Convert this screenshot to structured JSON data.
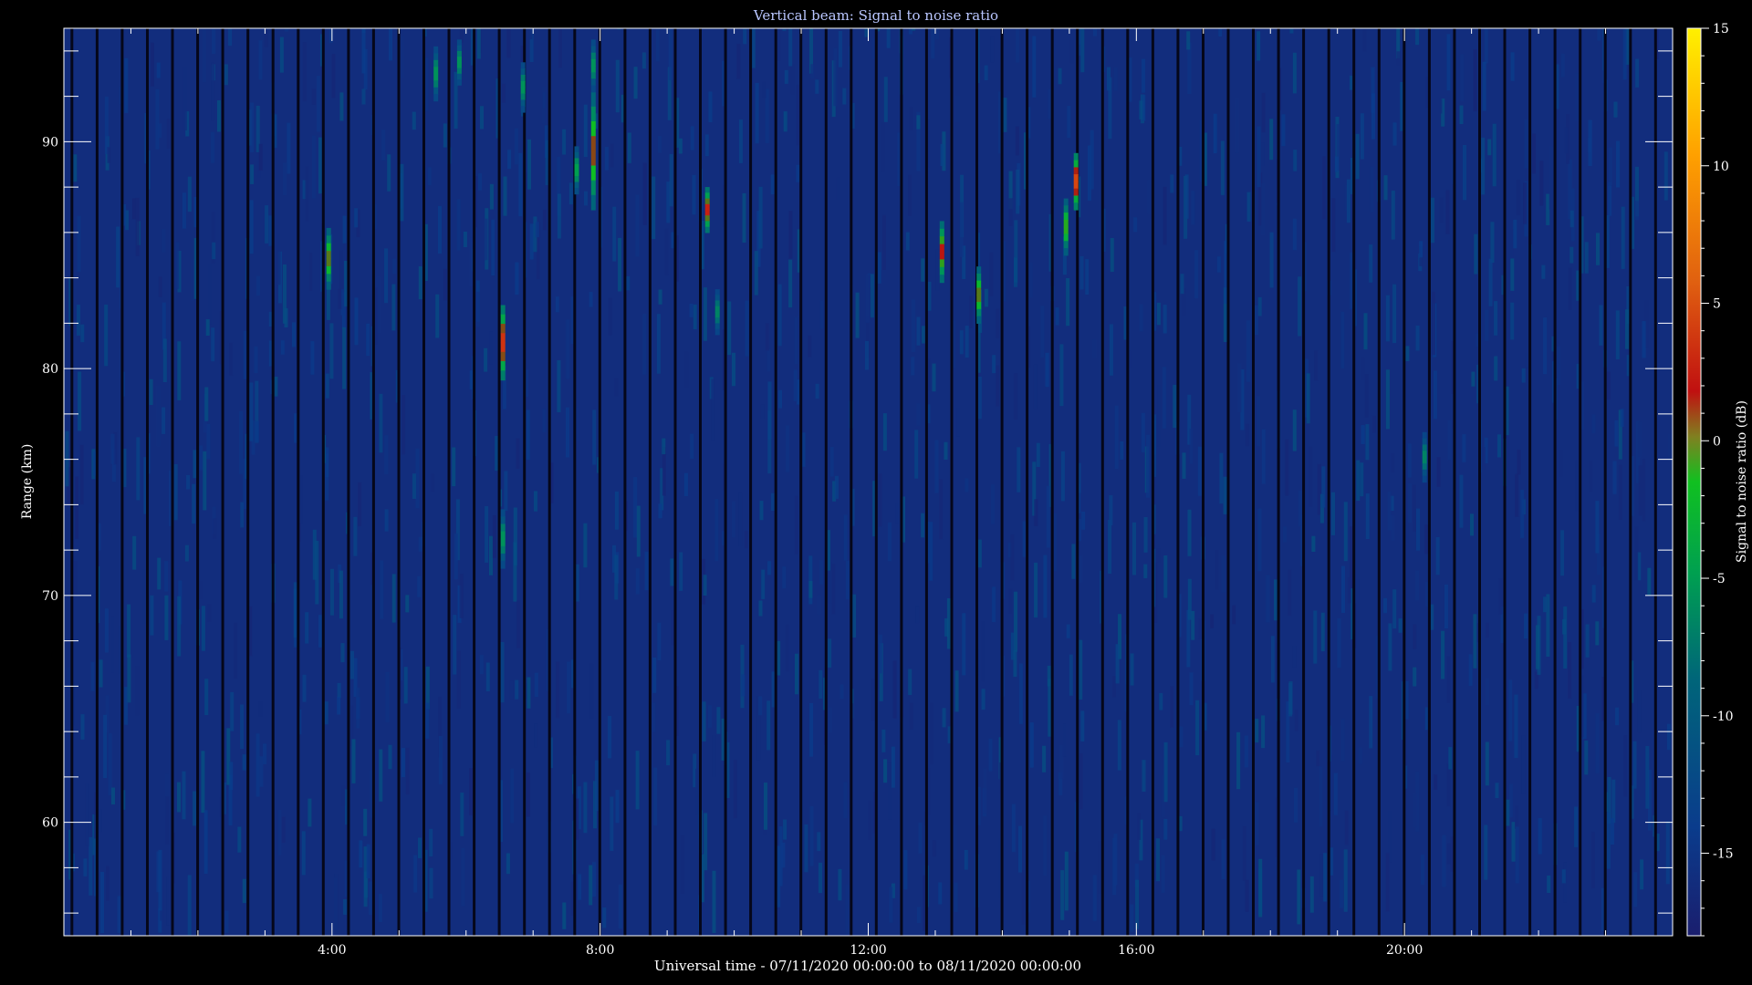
{
  "chart_data": {
    "type": "heatmap",
    "title": "Vertical beam: Signal to noise ratio",
    "xlabel": "Universal time - 07/11/2020 00:00:00 to 08/11/2020 00:00:00",
    "ylabel": "Range (km)",
    "colorbar_label": "Signal to noise ratio (dB)",
    "x_unit": "hours UT",
    "xlim": [
      0,
      24
    ],
    "ylim": [
      55,
      95
    ],
    "zlim": [
      -18,
      15
    ],
    "x_ticks": [
      4,
      8,
      12,
      16,
      20
    ],
    "x_tick_labels": [
      "4:00",
      "8:00",
      "12:00",
      "16:00",
      "20:00"
    ],
    "y_ticks": [
      60,
      70,
      80,
      90
    ],
    "y_tick_labels": [
      "60",
      "70",
      "80",
      "90"
    ],
    "colorbar_ticks": [
      15,
      10,
      5,
      0,
      -5,
      -10,
      -15
    ],
    "colorbar_tick_labels": [
      "15",
      "10",
      "5",
      "0",
      "-5",
      "-10",
      "-15"
    ],
    "background_snr_db": -16,
    "colormap": [
      "#1a1e6e",
      "#0a3c8c",
      "#00647a",
      "#00a050",
      "#10c020",
      "#c01010",
      "#e06010",
      "#ffa000",
      "#fff000"
    ],
    "echoes": [
      {
        "t": 3.95,
        "r_min": 83.5,
        "r_max": 86.2,
        "snr_db": 1
      },
      {
        "t": 5.55,
        "r_min": 91.8,
        "r_max": 94.2,
        "snr_db": -5
      },
      {
        "t": 5.9,
        "r_min": 92.5,
        "r_max": 94.5,
        "snr_db": -5
      },
      {
        "t": 6.55,
        "r_min": 79.5,
        "r_max": 82.8,
        "snr_db": 5
      },
      {
        "t": 6.55,
        "r_min": 71.2,
        "r_max": 73.8,
        "snr_db": -5
      },
      {
        "t": 6.85,
        "r_min": 91.3,
        "r_max": 93.5,
        "snr_db": -5
      },
      {
        "t": 7.65,
        "r_min": 87.7,
        "r_max": 89.8,
        "snr_db": -4
      },
      {
        "t": 7.9,
        "r_min": 87.0,
        "r_max": 92.2,
        "snr_db": 2
      },
      {
        "t": 7.9,
        "r_min": 92.2,
        "r_max": 94.5,
        "snr_db": -5
      },
      {
        "t": 9.6,
        "r_min": 86.0,
        "r_max": 88.0,
        "snr_db": 4
      },
      {
        "t": 9.75,
        "r_min": 81.5,
        "r_max": 83.5,
        "snr_db": -6
      },
      {
        "t": 13.1,
        "r_min": 83.8,
        "r_max": 86.5,
        "snr_db": 3
      },
      {
        "t": 13.65,
        "r_min": 82.0,
        "r_max": 84.5,
        "snr_db": 1
      },
      {
        "t": 14.95,
        "r_min": 85.0,
        "r_max": 87.5,
        "snr_db": 0
      },
      {
        "t": 15.1,
        "r_min": 87.0,
        "r_max": 89.5,
        "snr_db": 6
      },
      {
        "t": 20.3,
        "r_min": 75.0,
        "r_max": 77.2,
        "snr_db": -6
      }
    ]
  }
}
